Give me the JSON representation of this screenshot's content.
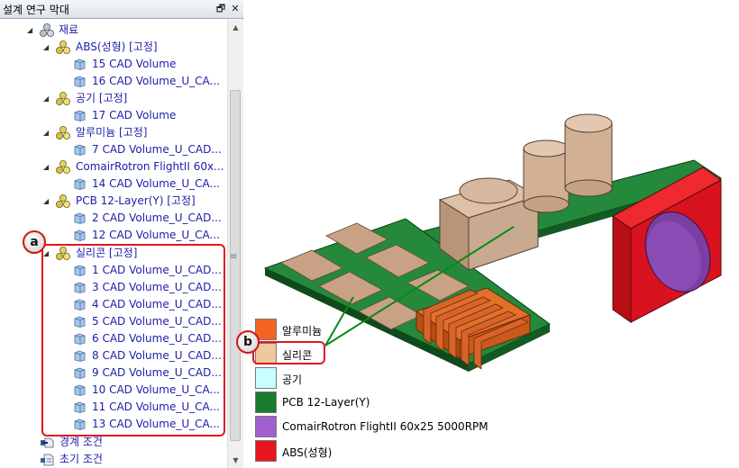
{
  "window": {
    "title": "설계 연구 막대",
    "pin_icon": "pin-icon",
    "close_icon": "close-icon"
  },
  "tree": {
    "materials_label": "재료",
    "groups": [
      {
        "label": "ABS(성형) [고정]",
        "items": [
          "15 CAD Volume",
          "16 CAD Volume_U_CA..."
        ]
      },
      {
        "label": "공기 [고정]",
        "items": [
          "17 CAD Volume"
        ]
      },
      {
        "label": "알루미늄 [고정]",
        "items": [
          "7 CAD Volume_U_CAD..."
        ]
      },
      {
        "label": "ComairRotron FlightII 60x...",
        "items": [
          "14 CAD Volume_U_CA..."
        ]
      },
      {
        "label": "PCB 12-Layer(Y) [고정]",
        "items": [
          "2 CAD Volume_U_CAD...",
          "12 CAD Volume_U_CA..."
        ]
      },
      {
        "label": "실리콘 [고정]",
        "items": [
          "1 CAD Volume_U_CAD...",
          "3 CAD Volume_U_CAD...",
          "4 CAD Volume_U_CAD...",
          "5 CAD Volume_U_CAD...",
          "6 CAD Volume_U_CAD...",
          "8 CAD Volume_U_CAD...",
          "9 CAD Volume_U_CAD...",
          "10 CAD Volume_U_CA...",
          "11 CAD Volume_U_CA...",
          "13 CAD Volume_U_CA..."
        ]
      }
    ],
    "bottom_items": [
      "경계 조건",
      "초기 조건"
    ]
  },
  "callouts": {
    "a": "a",
    "b": "b"
  },
  "legend": [
    {
      "label": "알루미늄",
      "color": "#f26522"
    },
    {
      "label": "실리콘",
      "color": "#f0c8a0"
    },
    {
      "label": "공기",
      "color": "#c8ffff"
    },
    {
      "label": "PCB 12-Layer(Y)",
      "color": "#1a7a2e"
    },
    {
      "label": "ComairRotron FlightII 60x25 5000RPM",
      "color": "#a060d0"
    },
    {
      "label": "ABS(성형)",
      "color": "#e8141e"
    }
  ],
  "colors": {
    "tree_text": "#1d1daa",
    "highlight": "#e0161e",
    "pcb": "#1a7a2e",
    "silicone": "#c8a088",
    "aluminum": "#d2501e",
    "abs": "#d8121e",
    "fan": "#7a3fa0"
  }
}
